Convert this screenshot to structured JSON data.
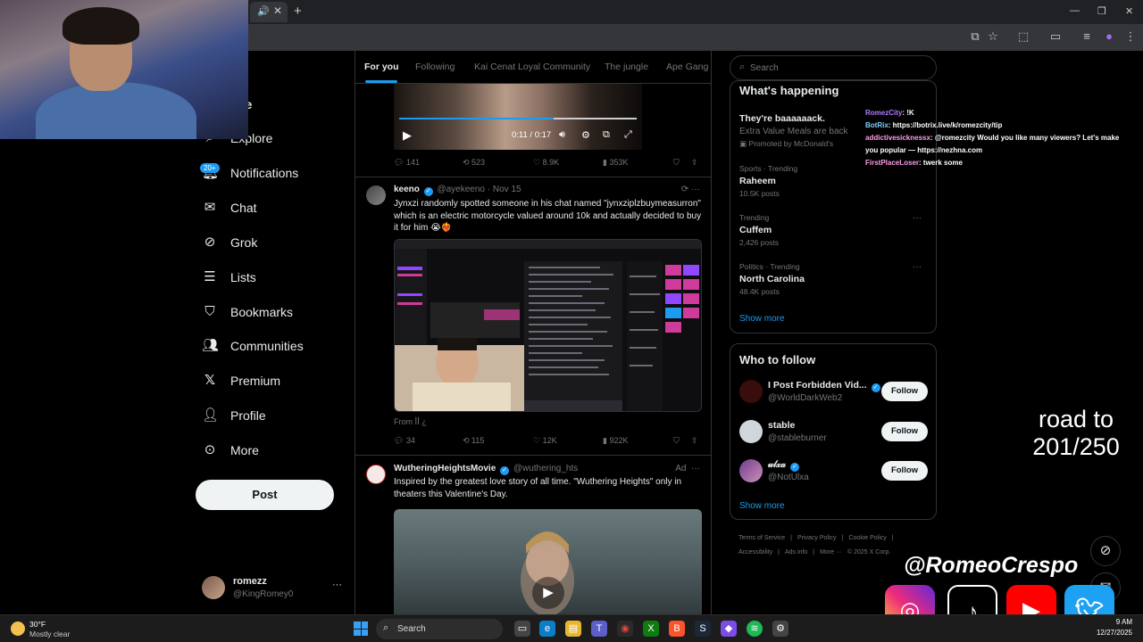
{
  "browser": {
    "tab_close": "✕",
    "new_tab": "+",
    "window_controls": [
      "—",
      "❐",
      "✕"
    ]
  },
  "left_nav": {
    "items": [
      {
        "label": "Home",
        "icon": "home-icon"
      },
      {
        "label": "Explore",
        "icon": "search-icon"
      },
      {
        "label": "Notifications",
        "icon": "bell-icon",
        "badge": "20+"
      },
      {
        "label": "Chat",
        "icon": "mail-icon"
      },
      {
        "label": "Grok",
        "icon": "grok-icon"
      },
      {
        "label": "Lists",
        "icon": "list-icon"
      },
      {
        "label": "Bookmarks",
        "icon": "bookmark-icon"
      },
      {
        "label": "Communities",
        "icon": "people-icon"
      },
      {
        "label": "Premium",
        "icon": "x-logo-icon"
      },
      {
        "label": "Profile",
        "icon": "person-icon"
      },
      {
        "label": "More",
        "icon": "more-circle-icon"
      }
    ],
    "home_visible": "me",
    "post_button": "Post",
    "account": {
      "name": "romezz",
      "handle": "@KingRomey0"
    }
  },
  "feed": {
    "tabs": [
      "For you",
      "Following",
      "Kai Cenat Loyal Community",
      "The jungle",
      "Ape Gang"
    ],
    "active_tab": "For you",
    "video1": {
      "time": "0:11 / 0:17",
      "progress": 0.65
    },
    "post1_actions": {
      "replies": "141",
      "reposts": "523",
      "likes": "8.9K",
      "views": "353K"
    },
    "post2": {
      "name": "keeno",
      "handle": "@ayekeeno",
      "date": "Nov 15",
      "text": "Jynxzi randomly spotted someone in his chat named \"jynxziplzbuymeasurron\" which is an electric motorcycle valued around 10k and actually decided to buy it for him 😭❤️‍🔥",
      "from": "From ꟾꟾ ¿",
      "actions": {
        "replies": "34",
        "reposts": "115",
        "likes": "12K",
        "views": "922K"
      }
    },
    "post3": {
      "name": "WutheringHeightsMovie",
      "handle": "@wuthering_hts",
      "ad": "Ad",
      "text": "Inspired by the greatest love story of all time. \"Wuthering Heights\" only in theaters this Valentine's Day."
    }
  },
  "right": {
    "search_placeholder": "Search",
    "whats_happening": "What's happening",
    "promo": {
      "title": "They're baaaaaack.",
      "subtitle": "Extra Value Meals are back",
      "promoted": "Promoted by McDonald's"
    },
    "trends": [
      {
        "context": "Sports · Trending",
        "title": "Raheem",
        "count": "10.5K posts"
      },
      {
        "context": "Trending",
        "title": "Cuffem",
        "count": "2,426 posts"
      },
      {
        "context": "Politics · Trending",
        "title": "North Carolina",
        "count": "48.4K posts"
      }
    ],
    "show_more": "Show more",
    "who_to_follow": "Who to follow",
    "follow_label": "Follow",
    "suggestions": [
      {
        "name": "I Post Forbidden Vid...",
        "handle": "@WorldDarkWeb2",
        "verified": true
      },
      {
        "name": "stable",
        "handle": "@stableburner",
        "verified": false
      },
      {
        "name": "𝓊𝓁𝓍𝒶",
        "handle": "@NotUlxa",
        "verified": true
      }
    ],
    "footer": [
      "Terms of Service",
      "|",
      "Privacy Policy",
      "|",
      "Cookie Policy",
      "|",
      "Accessibility",
      "|",
      "Ads info",
      "|",
      "More ···",
      "© 2025 X Corp."
    ]
  },
  "stream": {
    "chat": [
      {
        "user": "RomezCity",
        "msg": ": !K"
      },
      {
        "user": "BotRix",
        "msg": ": https://botrix.live/k/romezcity/tip"
      },
      {
        "user": "addictivesicknessx",
        "msg": ": @romezcity Would you like many viewers? Let's make you popular — https://nezhna.com"
      },
      {
        "user": "FirstPlaceLoser",
        "msg": ": twerk some"
      }
    ],
    "goal_line1": "road to",
    "goal_line2": "201/250",
    "streamer_name": "@RomeoCrespo"
  },
  "taskbar": {
    "temp": "30°F",
    "weather": "Mostly clear",
    "search": "Search",
    "time": "9 AM",
    "date": "12/27/2025"
  }
}
